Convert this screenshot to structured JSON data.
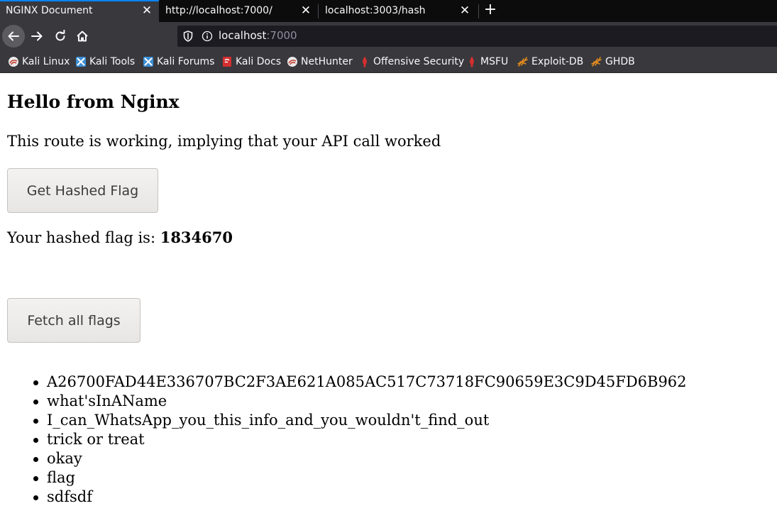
{
  "browser": {
    "tabs": [
      {
        "title": "NGINX Document",
        "active": true
      },
      {
        "title": "http://localhost:7000/",
        "active": false
      },
      {
        "title": "localhost:3003/hash",
        "active": false
      }
    ],
    "new_tab_icon": "plus-icon",
    "close_tab_icon": "close-icon",
    "url": {
      "host": "localhost",
      "port": ":7000"
    },
    "bookmarks": [
      {
        "label": "Kali Linux",
        "icon": "kali-icon"
      },
      {
        "label": "Kali Tools",
        "icon": "kali-tools-icon"
      },
      {
        "label": "Kali Forums",
        "icon": "kali-forums-icon"
      },
      {
        "label": "Kali Docs",
        "icon": "kali-docs-icon"
      },
      {
        "label": "NetHunter",
        "icon": "nethunter-icon"
      },
      {
        "label": "Offensive Security",
        "icon": "offsec-icon"
      },
      {
        "label": "MSFU",
        "icon": "msfu-icon"
      },
      {
        "label": "Exploit-DB",
        "icon": "exploit-db-icon"
      },
      {
        "label": "GHDB",
        "icon": "ghdb-icon"
      }
    ],
    "colors": {
      "tabbar": "#0c0c0d",
      "toolbar": "#38383d",
      "accent": "#0a84ff",
      "urlbar": "#1c1b22"
    }
  },
  "page": {
    "heading": "Hello from Nginx",
    "subtitle": "This route is working, implying that your API call worked",
    "hash_button": "Get Hashed Flag",
    "hash_prefix": "Your hashed flag is: ",
    "hash_value": "1834670",
    "fetch_button": "Fetch all flags",
    "flags": [
      "A26700FAD44E336707BC2F3AE621A085AC517C73718FC90659E3C9D45FD6B962",
      "what'sInAName",
      "I_can_WhatsApp_you_this_info_and_you_wouldn't_find_out",
      "trick or treat",
      "okay",
      "flag",
      "sdfsdf"
    ]
  }
}
